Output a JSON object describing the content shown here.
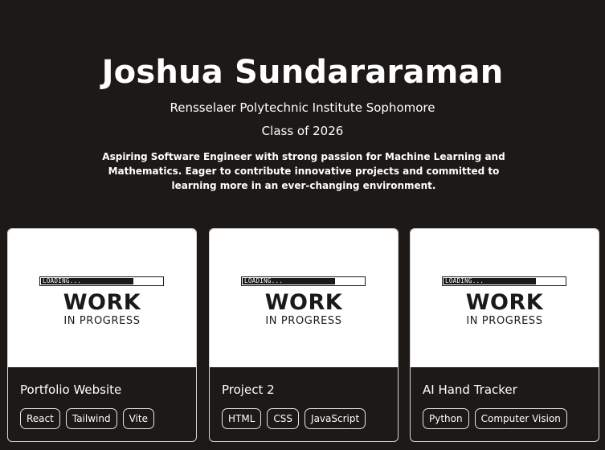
{
  "hero": {
    "name": "Joshua Sundararaman",
    "school": "Rensselaer Polytechnic Institute Sophomore",
    "class_year": "Class of 2026",
    "bio": "Aspiring Software Engineer with strong passion for Machine Learning and Mathematics. Eager to contribute innovative projects and committed to learning more in an ever-changing environment."
  },
  "placeholder": {
    "loading_text": "LOADING...",
    "loading_progress": 0.75,
    "main_text": "WORK",
    "sub_text": "IN PROGRESS"
  },
  "projects": [
    {
      "title": "Portfolio Website",
      "tags": [
        "React",
        "Tailwind",
        "Vite"
      ]
    },
    {
      "title": "Project 2",
      "tags": [
        "HTML",
        "CSS",
        "JavaScript"
      ]
    },
    {
      "title": "AI Hand Tracker",
      "tags": [
        "Python",
        "Computer Vision"
      ]
    }
  ],
  "colors": {
    "background": "#1c1917",
    "text": "#ffffff",
    "card_border": "#d6d3d1",
    "placeholder_bg": "#ffffff",
    "placeholder_ink": "#1a1a1a"
  }
}
